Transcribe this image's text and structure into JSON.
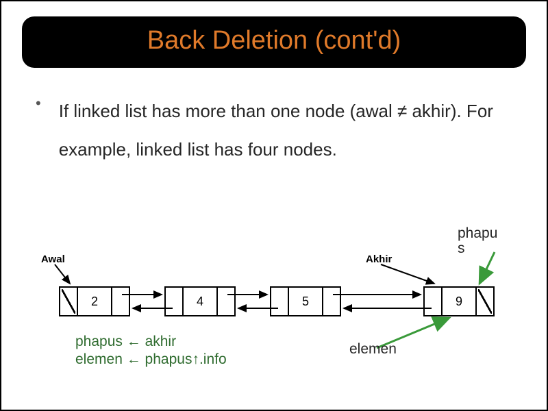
{
  "title": "Back Deletion (cont'd)",
  "bullet_text": "If linked list has more than one node (awal ≠ akhir). For example, linked list has four nodes.",
  "phapus_label_line1": "phapu",
  "phapus_label_line2": "s",
  "code_line1": "phapus ← akhir",
  "code_line2": "elemen ← phapus↑.info",
  "elemen_label": "elemen",
  "diagram": {
    "awal": "Awal",
    "akhir": "Akhir",
    "nodes": [
      "2",
      "4",
      "5",
      "9"
    ]
  }
}
